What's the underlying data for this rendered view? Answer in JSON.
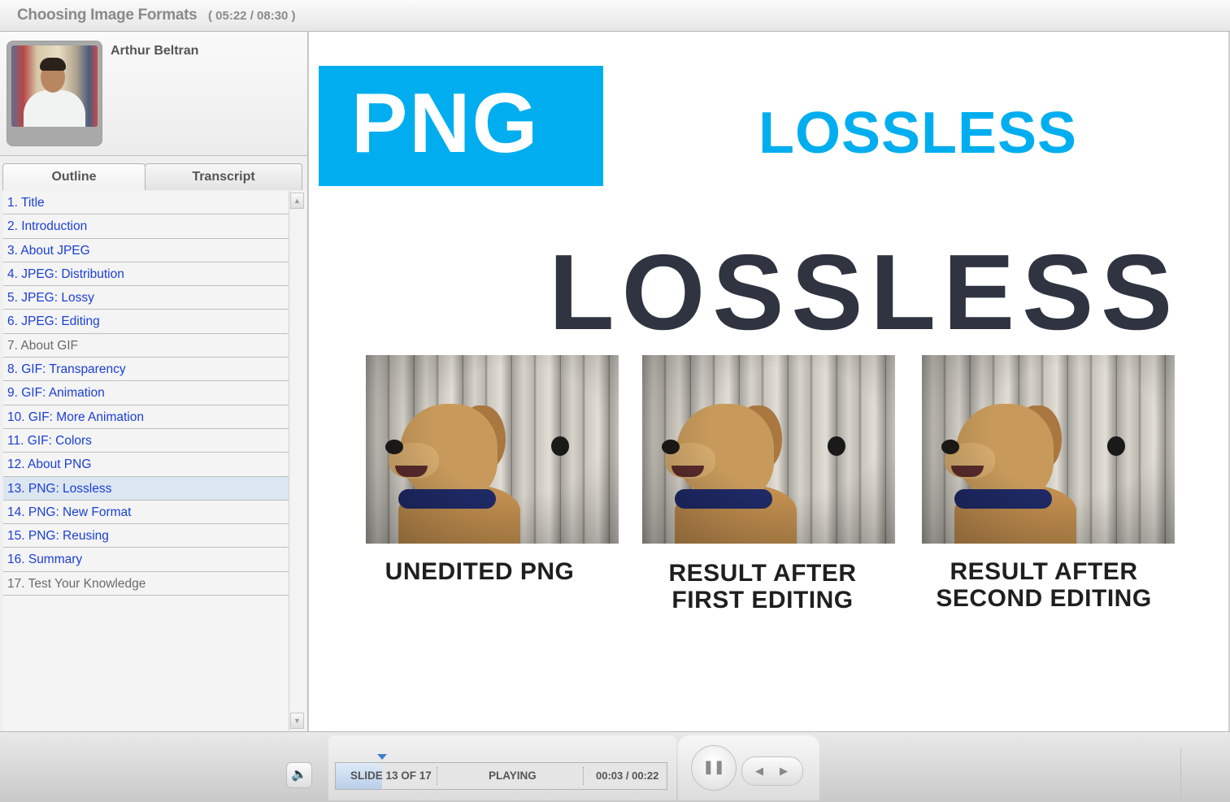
{
  "header": {
    "course_title": "Choosing Image Formats",
    "course_time": "( 05:22 / 08:30 )"
  },
  "presenter": {
    "name": "Arthur Beltran"
  },
  "tabs": [
    {
      "label": "Outline",
      "active": true
    },
    {
      "label": "Transcript",
      "active": false
    }
  ],
  "outline": {
    "items": [
      {
        "label": "1. Title",
        "state": "unvisited"
      },
      {
        "label": "2. Introduction",
        "state": "unvisited"
      },
      {
        "label": "3. About JPEG",
        "state": "unvisited"
      },
      {
        "label": "4. JPEG: Distribution",
        "state": "unvisited"
      },
      {
        "label": "5. JPEG: Lossy",
        "state": "unvisited"
      },
      {
        "label": "6. JPEG: Editing",
        "state": "unvisited"
      },
      {
        "label": "7. About GIF",
        "state": "visited"
      },
      {
        "label": "8. GIF: Transparency",
        "state": "unvisited"
      },
      {
        "label": "9. GIF: Animation",
        "state": "unvisited"
      },
      {
        "label": "10.  GIF: More Animation",
        "state": "unvisited"
      },
      {
        "label": "11.  GIF: Colors",
        "state": "unvisited"
      },
      {
        "label": "12.  About PNG",
        "state": "unvisited"
      },
      {
        "label": "13.  PNG: Lossless",
        "state": "current"
      },
      {
        "label": "14.  PNG: New Format",
        "state": "unvisited"
      },
      {
        "label": "15.  PNG: Reusing",
        "state": "unvisited"
      },
      {
        "label": "16.  Summary",
        "state": "unvisited"
      },
      {
        "label": "17.  Test Your Knowledge",
        "state": "visited"
      }
    ]
  },
  "slide": {
    "badge": "PNG",
    "heading": "LOSSLESS",
    "big_heading": "LOSSLESS",
    "captions": [
      "UNEDITED PNG",
      "RESULT AFTER FIRST EDITING",
      "RESULT AFTER SECOND EDITING"
    ],
    "colors": {
      "accent": "#00aeef",
      "dark_text": "#2f3440"
    }
  },
  "player": {
    "slide_counter": "SLIDE 13 OF 17",
    "status": "PLAYING",
    "time": "00:03 / 00:22",
    "progress": 0.14,
    "icons": {
      "volume": "volume-icon",
      "pause": "pause-icon",
      "prev": "prev-icon",
      "next": "next-icon"
    }
  }
}
